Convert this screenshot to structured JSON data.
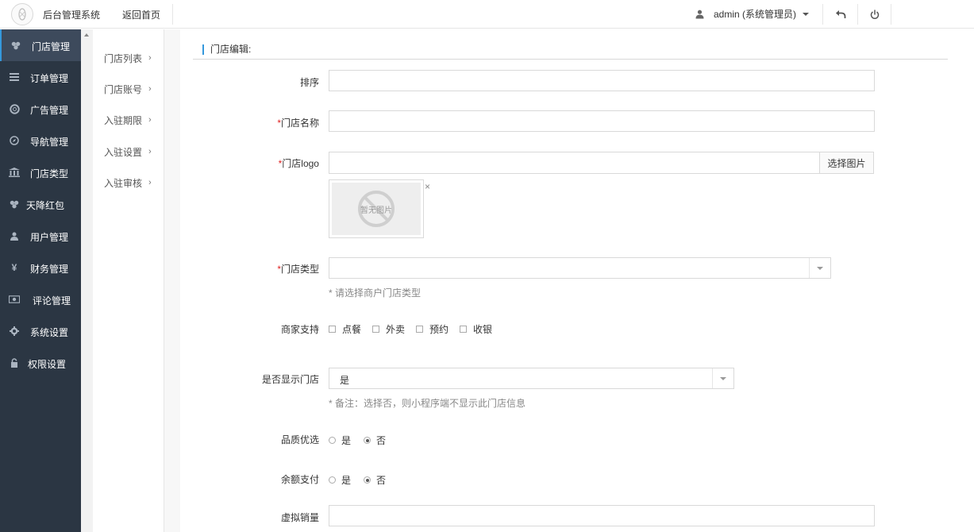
{
  "topbar": {
    "app_title": "后台管理系统",
    "home_link": "返回首页",
    "user_label": "admin (系统管理员)"
  },
  "sidebar": {
    "items": [
      {
        "label": "门店管理",
        "icon": "stores-icon",
        "active": true
      },
      {
        "label": "订单管理",
        "icon": "list-icon"
      },
      {
        "label": "广告管理",
        "icon": "lifebuoy-icon"
      },
      {
        "label": "导航管理",
        "icon": "compass-icon"
      },
      {
        "label": "门店类型",
        "icon": "bank-icon"
      },
      {
        "label": "天降红包",
        "icon": "redpacket-icon"
      },
      {
        "label": "用户管理",
        "icon": "user-icon"
      },
      {
        "label": "财务管理",
        "icon": "yen-icon"
      },
      {
        "label": "评论管理",
        "icon": "money-icon"
      },
      {
        "label": "系统设置",
        "icon": "gear-icon"
      },
      {
        "label": "权限设置",
        "icon": "lock-icon"
      }
    ]
  },
  "subnav": {
    "items": [
      "门店列表",
      "门店账号",
      "入驻期限",
      "入驻设置",
      "入驻审核"
    ]
  },
  "form": {
    "section_title": "门店编辑:",
    "sort_label": "排序",
    "sort_value": "",
    "name_label": "门店名称",
    "name_value": "",
    "logo_label": "门店logo",
    "logo_value": "",
    "pick_image_button": "选择图片",
    "no_image_text": "暂无图片",
    "close_mark": "×",
    "type_label": "门店类型",
    "type_value": "",
    "type_hint": "* 请选择商户门店类型",
    "support_label": "商家支持",
    "support_options": [
      "点餐",
      "外卖",
      "预约",
      "收银"
    ],
    "show_label": "是否显示门店",
    "show_value": "是",
    "show_hint": "* 备注：选择否，则小程序端不显示此门店信息",
    "quality_label": "品质优选",
    "quality_options": [
      "是",
      "否"
    ],
    "quality_selected": "否",
    "balance_label": "余额支付",
    "balance_options": [
      "是",
      "否"
    ],
    "balance_selected": "否",
    "sales_label": "虚拟销量",
    "sales_value": ""
  }
}
